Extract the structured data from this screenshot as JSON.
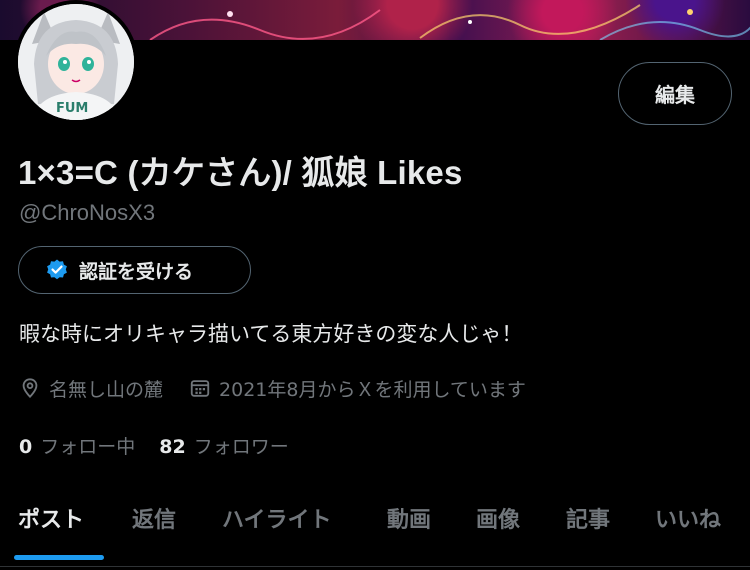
{
  "profile": {
    "display_name": "1×3=C (カケさん)/ 狐娘 Likes",
    "handle": "@ChroNosX3",
    "avatar_text": "FUM",
    "bio": "暇な時にオリキャラ描いてる東方好きの変な人じゃ！",
    "location": "名無し山の麓",
    "joined": "2021年8月からＸを利用しています",
    "following_count": "0",
    "following_label": "フォロー中",
    "followers_count": "82",
    "followers_label": "フォロワー"
  },
  "buttons": {
    "edit_label": "編集",
    "verify_label": "認証を受ける"
  },
  "tabs": [
    {
      "label": "ポスト",
      "active": true
    },
    {
      "label": "返信",
      "active": false
    },
    {
      "label": "ハイライト",
      "active": false
    },
    {
      "label": "動画",
      "active": false
    },
    {
      "label": "画像",
      "active": false
    },
    {
      "label": "記事",
      "active": false
    },
    {
      "label": "いいね",
      "active": false
    }
  ],
  "colors": {
    "accent": "#1d9bf0",
    "background": "#000000",
    "text_primary": "#e7e9ea",
    "text_secondary": "#71767b",
    "border": "#536471"
  },
  "icons": {
    "verify": "verified-badge-icon",
    "location": "location-pin-icon",
    "calendar": "calendar-icon"
  }
}
